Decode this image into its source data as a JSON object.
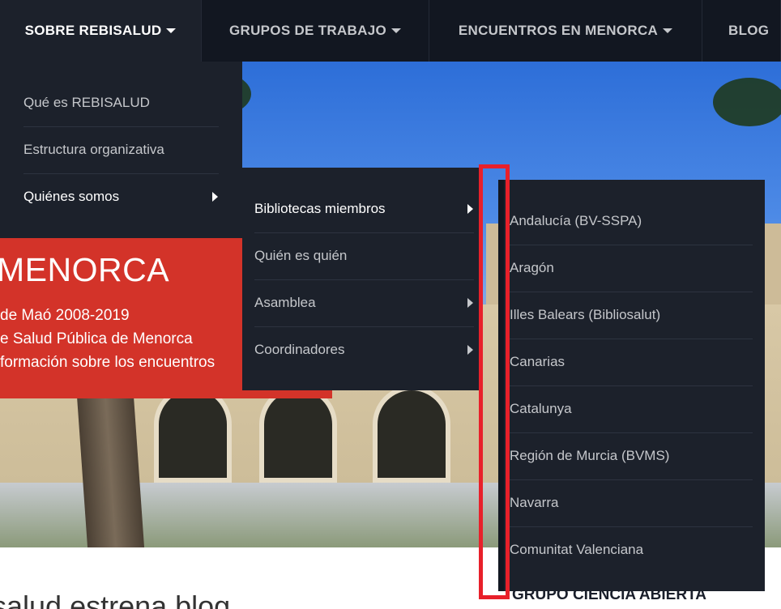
{
  "topnav": {
    "items": [
      {
        "label": "SOBRE REBISALUD"
      },
      {
        "label": "GRUPOS DE TRABAJO"
      },
      {
        "label": "ENCUENTROS EN MENORCA"
      },
      {
        "label": "BLOG"
      }
    ]
  },
  "menu_sobre": {
    "items": [
      {
        "label": "Qué es REBISALUD"
      },
      {
        "label": "Estructura organizativa"
      },
      {
        "label": "Quiénes somos"
      }
    ]
  },
  "menu_quienes": {
    "items": [
      {
        "label": "Bibliotecas miembros"
      },
      {
        "label": "Quién es quién"
      },
      {
        "label": "Asamblea"
      },
      {
        "label": "Coordinadores"
      }
    ]
  },
  "menu_bibliotecas": {
    "items": [
      {
        "label": "Andalucía (BV-SSPA)"
      },
      {
        "label": "Aragón"
      },
      {
        "label": "Illes Balears (Bibliosalut)"
      },
      {
        "label": "Canarias"
      },
      {
        "label": "Catalunya"
      },
      {
        "label": "Región de Murcia (BVMS)"
      },
      {
        "label": "Navarra"
      },
      {
        "label": "Comunitat Valenciana"
      }
    ]
  },
  "hero": {
    "title": "MENORCA",
    "line1": "de Maó 2008-2019",
    "line2": "e Salud Pública de Menorca",
    "line3": "formación sobre los encuentros"
  },
  "content": {
    "heading": "salud estrena blog",
    "sidebar_heading": "GRUPO CIENCIA ABIERTA"
  },
  "colors": {
    "nav_bg": "#121721",
    "menu_bg": "#1c212b",
    "banner_red": "#d33329",
    "highlight_red": "#e8202a"
  }
}
